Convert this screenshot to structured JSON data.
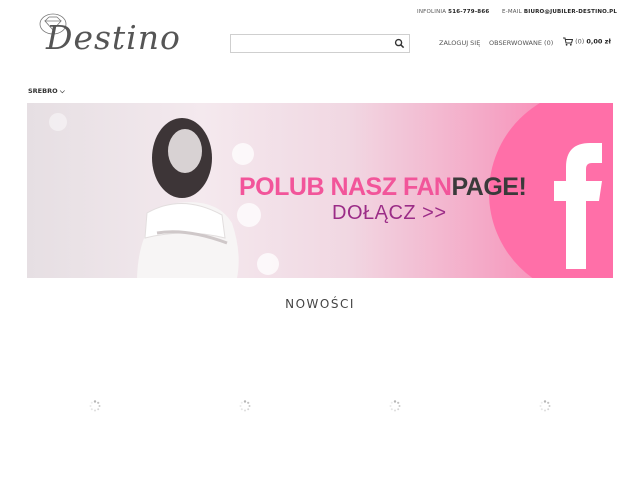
{
  "header": {
    "logo_text": "Destino",
    "infolinia_label": "INFOLINIA",
    "infolinia_value": "516-779-866",
    "email_label": "E-MAIL",
    "email_value": "BIURO@JUBILER-DESTINO.PL",
    "search": {
      "value": "",
      "placeholder": ""
    },
    "login_label": "ZALOGUJ SIĘ",
    "watched_label": "OBSERWOWANE (0)",
    "cart_count": "(0)",
    "cart_total": "0,00 zł"
  },
  "nav": {
    "items": [
      {
        "label": "SREBRO ⌵"
      }
    ]
  },
  "banner": {
    "headline_pink": "POLUB NASZ FAN",
    "headline_dark": "PAGE!",
    "sub": "DOŁĄCZ >>"
  },
  "section": {
    "title": "NOWOŚCI"
  },
  "colors": {
    "accent_pink": "#ff6fa8",
    "banner_text_pink": "#f2559a",
    "banner_sub": "#9b2c87"
  },
  "icons": [
    "diamond-icon",
    "search-icon",
    "cart-icon",
    "chevron-down-icon",
    "facebook-f-icon",
    "loading-spinner-icon"
  ]
}
